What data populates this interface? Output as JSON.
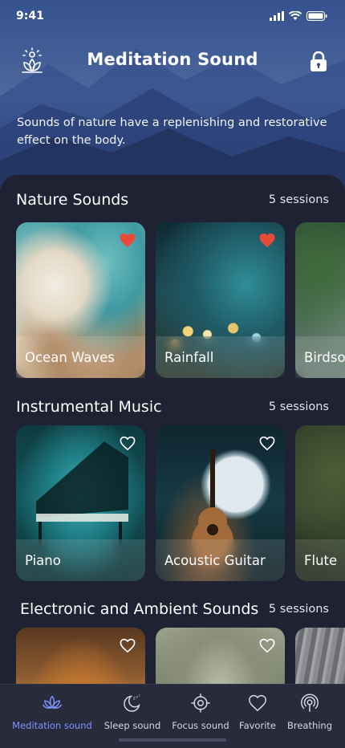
{
  "status_bar": {
    "time": "9:41"
  },
  "header": {
    "title": "Meditation Sound",
    "left_icon": "lotus-sun-icon",
    "right_icon": "lock-icon"
  },
  "tagline": "Sounds of nature have a replenishing and restorative effect on the body.",
  "sections": [
    {
      "title": "Nature Sounds",
      "count": "5 sessions",
      "cards": [
        {
          "label": "Ocean Waves",
          "favorite": true
        },
        {
          "label": "Rainfall",
          "favorite": true
        },
        {
          "label": "Birdsong",
          "favorite": false
        }
      ]
    },
    {
      "title": "Instrumental Music",
      "count": "5 sessions",
      "cards": [
        {
          "label": "Piano",
          "favorite": false
        },
        {
          "label": "Acoustic Guitar",
          "favorite": false
        },
        {
          "label": "Flute",
          "favorite": false
        }
      ]
    },
    {
      "title": "Electronic and Ambient Sounds",
      "count": "5 sessions",
      "cards": [
        {
          "label": "",
          "favorite": false
        },
        {
          "label": "",
          "favorite": false
        },
        {
          "label": "",
          "favorite": false
        }
      ]
    }
  ],
  "bottom_nav": [
    {
      "label": "Meditation sound",
      "icon": "lotus-icon",
      "active": true
    },
    {
      "label": "Sleep sound",
      "icon": "moon-zzz-icon",
      "active": false
    },
    {
      "label": "Focus sound",
      "icon": "target-icon",
      "active": false
    },
    {
      "label": "Favorite",
      "icon": "heart-icon",
      "active": false
    },
    {
      "label": "Breathing",
      "icon": "breathing-icon",
      "active": false
    }
  ],
  "colors": {
    "accent": "#8093ff",
    "favorite_red": "#e84a3a",
    "panel_bg": "#1e2233",
    "nav_bg": "#272b3b"
  }
}
